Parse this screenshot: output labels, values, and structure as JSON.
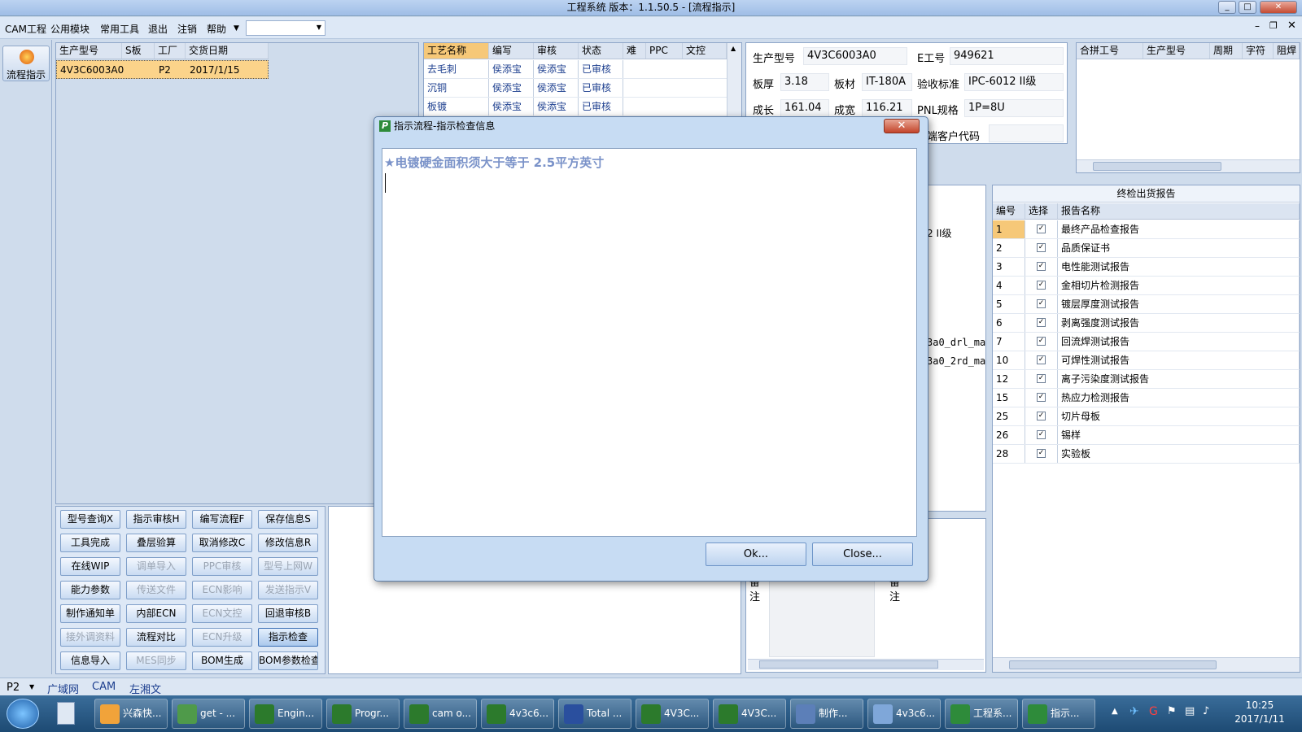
{
  "window": {
    "title": "工程系统   版本：1.1.50.5 - [流程指示]"
  },
  "menu": [
    "CAM工程",
    "公用模块",
    "常用工具",
    "退出",
    "注销",
    "帮助"
  ],
  "left": {
    "process_label": "流程指示"
  },
  "orders": {
    "headers": [
      "生产型号",
      "S板",
      "工厂",
      "交货日期"
    ],
    "rows": [
      [
        "4V3C6003A0",
        "",
        "P2",
        "2017/1/15"
      ]
    ]
  },
  "process": {
    "headers": [
      "工艺名称",
      "编写",
      "审核",
      "状态",
      "难",
      "PPC",
      "文控"
    ],
    "rows": [
      [
        "去毛刺",
        "侯添宝",
        "侯添宝",
        "已审核"
      ],
      [
        "沉铜",
        "侯添宝",
        "侯添宝",
        "已审核"
      ],
      [
        "板镀",
        "侯添宝",
        "侯添宝",
        "已审核"
      ]
    ]
  },
  "info": {
    "model_label": "生产型号",
    "model": "4V3C6003A0",
    "eno_label": "E工号",
    "eno": "949621",
    "thickness_label": "板厚",
    "thickness": "3.18",
    "material_label": "板材",
    "material": "IT-180A",
    "standard_label": "验收标准",
    "standard": "IPC-6012 II级",
    "length_label": "成长",
    "length": "161.04",
    "width_label": "成宽",
    "width": "116.21",
    "pnl_label": "PNL规格",
    "pnl": "1P=8U",
    "customer_label": "端客户代码",
    "customer": ""
  },
  "merge": {
    "headers": [
      "合拼工号",
      "生产型号",
      "周期",
      "字符",
      "阻焊"
    ]
  },
  "midpanel": {
    "frag1": "2 II级",
    "frag2": "3a0_drl_ma",
    "frag3": "3a0_2rd_ma",
    "note1": "备注",
    "note2": "备注"
  },
  "report": {
    "title": "终检出货报告",
    "headers": [
      "编号",
      "选择",
      "报告名称"
    ],
    "rows": [
      [
        "1",
        "最终产品检查报告"
      ],
      [
        "2",
        "品质保证书"
      ],
      [
        "3",
        "电性能测试报告"
      ],
      [
        "4",
        "金相切片检测报告"
      ],
      [
        "5",
        "镀层厚度测试报告"
      ],
      [
        "6",
        "剥离强度测试报告"
      ],
      [
        "7",
        "回流焊测试报告"
      ],
      [
        "10",
        "可焊性测试报告"
      ],
      [
        "12",
        "离子污染度测试报告"
      ],
      [
        "15",
        "热应力检测报告"
      ],
      [
        "25",
        "切片母板"
      ],
      [
        "26",
        "锡样"
      ],
      [
        "28",
        "实验板"
      ]
    ]
  },
  "buttons": [
    [
      "型号查询X",
      "指示审核H",
      "编写流程F",
      "保存信息S"
    ],
    [
      "工具完成",
      "叠层验算",
      "取消修改C",
      "修改信息R"
    ],
    [
      "在线WIP",
      "调单导入",
      "PPC审核",
      "型号上网W"
    ],
    [
      "能力参数",
      "传送文件",
      "ECN影响",
      "发送指示V"
    ],
    [
      "制作通知单",
      "内部ECN",
      "ECN文控",
      "回退审核B"
    ],
    [
      "接外调资料",
      "流程对比",
      "ECN升级",
      "指示检查"
    ],
    [
      "信息导入",
      "MES同步",
      "BOM生成",
      "BOM参数检查"
    ]
  ],
  "dialog": {
    "title": "指示流程-指示检查信息",
    "message": "★电镀硬金面积须大于等于 2.5平方英寸",
    "ok": "Ok...",
    "close": "Close..."
  },
  "status": {
    "factory": "P2",
    "net": "广域网",
    "dept": "CAM",
    "user": "左湘文"
  },
  "taskbar": {
    "items": [
      "兴森快...",
      "get - ...",
      "Engin...",
      "Progr...",
      "cam o...",
      "4v3c6...",
      "Total ...",
      "4V3C...",
      "4V3C...",
      "制作...",
      "4v3c6...",
      "工程系...",
      "指示..."
    ],
    "time": "10:25",
    "date": "2017/1/11"
  }
}
